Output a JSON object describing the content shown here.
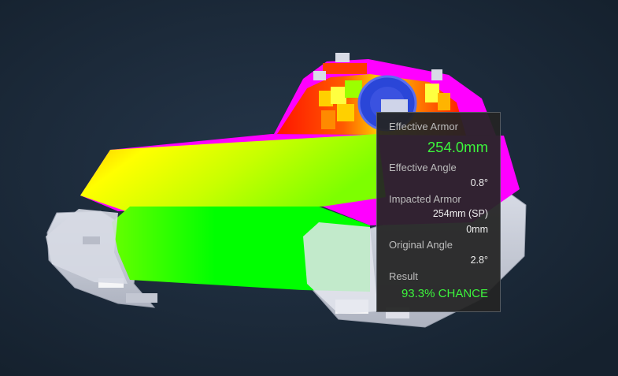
{
  "tooltip": {
    "effective_armor": {
      "label": "Effective Armor",
      "value": "254.0mm"
    },
    "effective_angle": {
      "label": "Effective Angle",
      "value": "0.8°"
    },
    "impacted_armor": {
      "label": "Impacted Armor",
      "values": [
        "254mm (SP)",
        "0mm"
      ]
    },
    "original_angle": {
      "label": "Original Angle",
      "value": "2.8°"
    },
    "result": {
      "label": "Result",
      "value": "93.3% CHANCE"
    }
  },
  "colors": {
    "background": "#1b2a3b",
    "armor_high": "#ff00ff",
    "armor_strong": "#ff1a00",
    "armor_mid": "#ffff00",
    "armor_low": "#00ff00",
    "impact_marker": "#2545d6",
    "tracks": "#c8ccd8",
    "tooltip_bg": "#242424",
    "result_green": "#3cf53c"
  }
}
